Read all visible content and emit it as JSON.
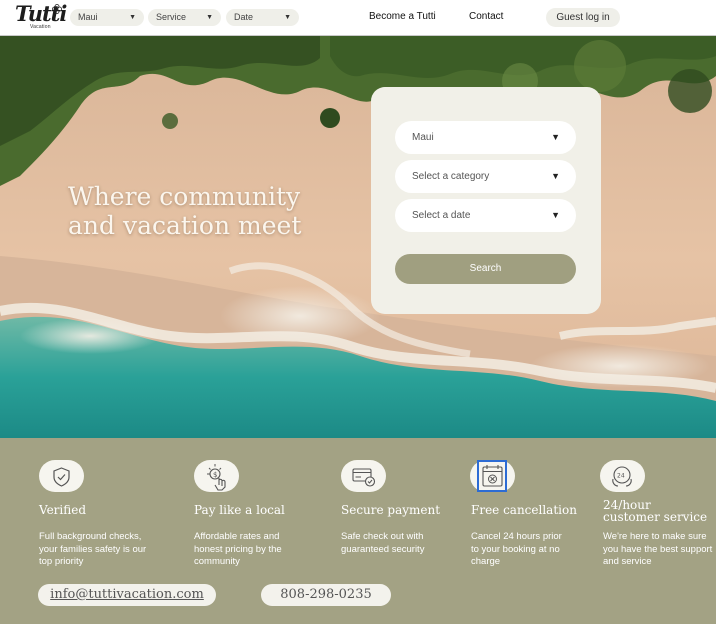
{
  "nav": {
    "logo_text": "Tutti",
    "logo_subtext": "Vacation",
    "dropdowns": [
      {
        "label": "Maui",
        "arrow": "▼"
      },
      {
        "label": "Service",
        "arrow": "▼"
      },
      {
        "label": "Date",
        "arrow": "▼"
      }
    ],
    "links": [
      {
        "label": "Become a Tutti"
      },
      {
        "label": "Contact"
      }
    ],
    "guest_login": "Guest log in"
  },
  "hero": {
    "headline_line1": "Where community",
    "headline_line2": "and vacation meet"
  },
  "search_card": {
    "fields": [
      {
        "label": "Maui",
        "arrow": "▼"
      },
      {
        "label": "Select a category",
        "arrow": "▼"
      },
      {
        "label": "Select a date",
        "arrow": "▼"
      }
    ],
    "search_label": "Search"
  },
  "features": [
    {
      "icon": "shield-check-icon",
      "title": "Verified",
      "desc": "Full background checks, your families safety is our top priority"
    },
    {
      "icon": "pointing-hand-icon",
      "title": "Pay like a local",
      "desc": "Affordable rates and honest pricing by the community"
    },
    {
      "icon": "credit-card-check-icon",
      "title": "Secure payment",
      "desc": "Safe check out with guaranteed security"
    },
    {
      "icon": "calendar-cancel-icon",
      "title": "Free cancellation",
      "desc": "Cancel 24 hours prior to your booking at no charge"
    },
    {
      "icon": "24hr-support-icon",
      "title": "24/hour customer service",
      "desc": "We're here to make sure you have the best support and service"
    }
  ],
  "contact": {
    "email": "info@tuttivacation.com",
    "phone": "808-298-0235"
  },
  "colors": {
    "band": "#a3a284",
    "search_button": "#a09f80",
    "card": "#f1f0e8"
  }
}
